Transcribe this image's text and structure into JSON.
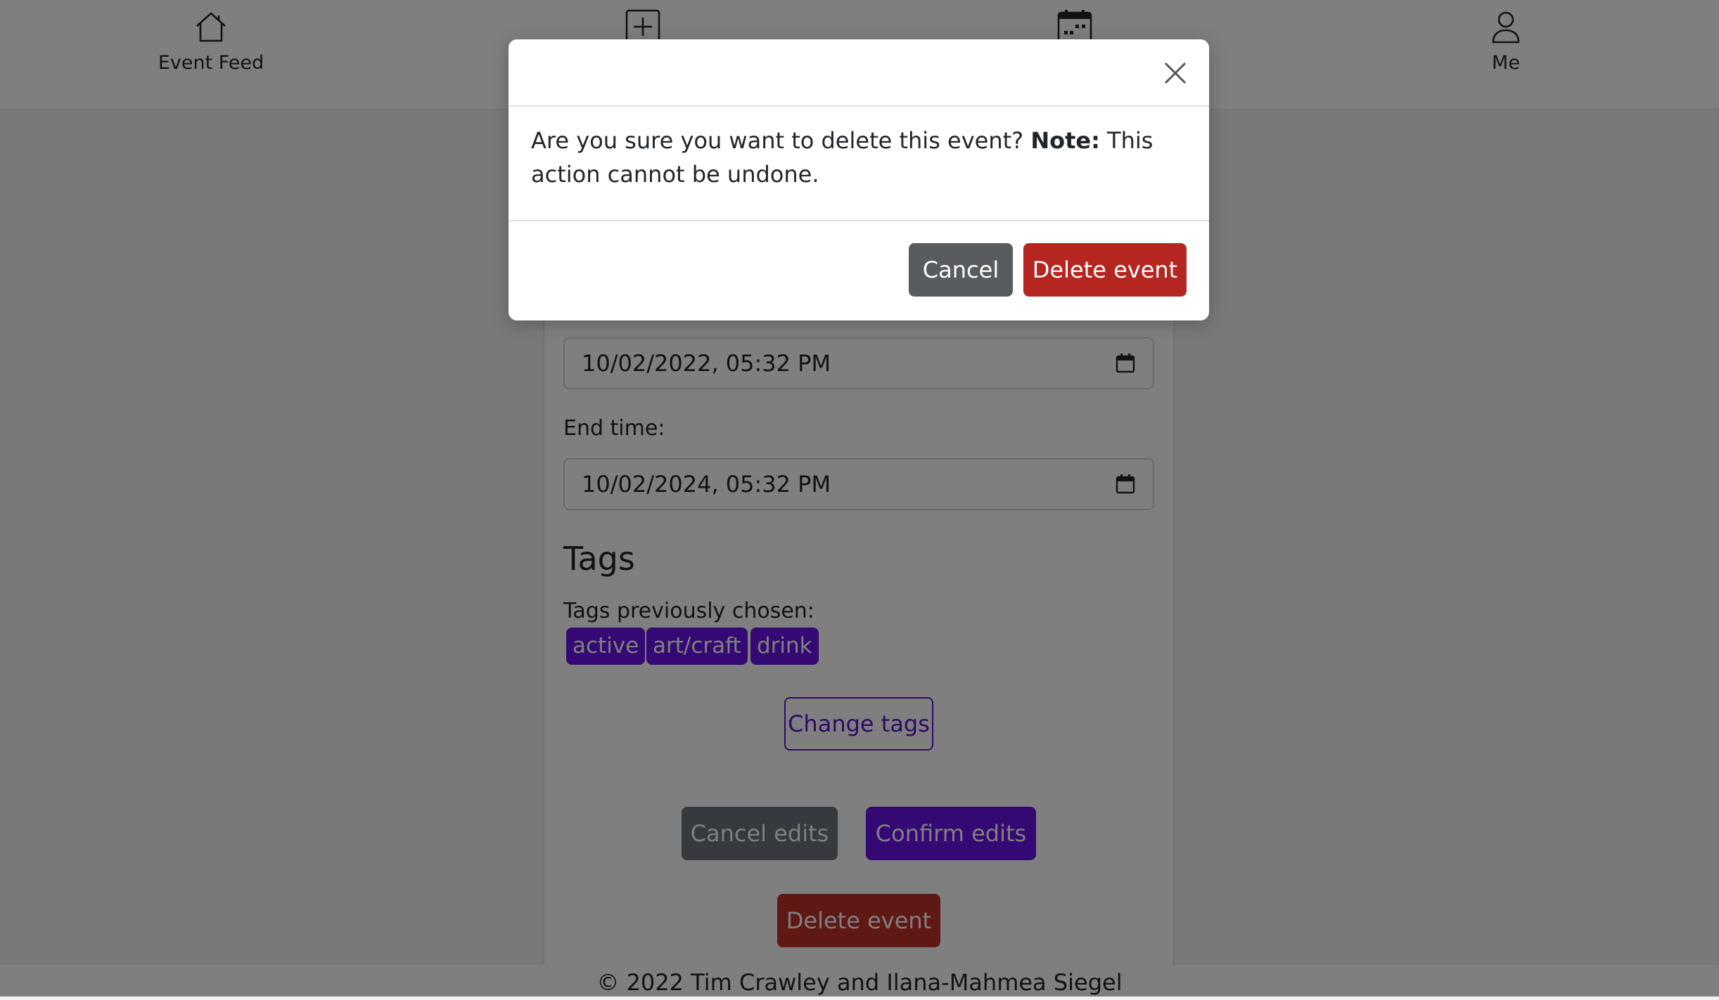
{
  "nav": {
    "items": [
      {
        "label": "Event Feed",
        "icon": "house-icon"
      },
      {
        "label": "",
        "icon": "plus-square-icon"
      },
      {
        "label": "",
        "icon": "calendar-icon"
      },
      {
        "label": "Me",
        "icon": "person-icon"
      }
    ]
  },
  "form": {
    "start_time_value": "10/02/2022, 05:32 PM",
    "end_time_label": "End time:",
    "end_time_value": "10/02/2024, 05:32 PM",
    "tags_heading": "Tags",
    "tags_previous_label": "Tags previously chosen:",
    "tags": [
      "active",
      "art/craft",
      "drink"
    ],
    "change_tags_label": "Change tags",
    "cancel_edits_label": "Cancel edits",
    "confirm_edits_label": "Confirm edits",
    "delete_event_label": "Delete event"
  },
  "footer": {
    "text": "© 2022 Tim Crawley and Ilana-Mahmea Siegel"
  },
  "modal": {
    "message_prefix": "Are you sure you want to delete this event? ",
    "note_label": "Note:",
    "message_suffix": " This action cannot be undone.",
    "cancel_label": "Cancel",
    "delete_label": "Delete event"
  },
  "colors": {
    "primary_purple": "#6b12e8",
    "danger_red": "#b52620",
    "secondary_gray": "#6c757d"
  }
}
